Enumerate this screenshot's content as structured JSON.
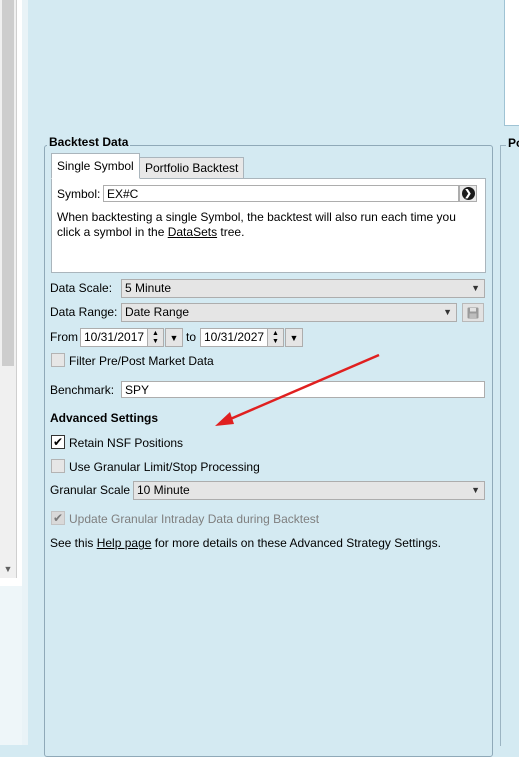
{
  "group_title": "Backtest Data",
  "right_group_title_partial": "Po",
  "tabs": [
    {
      "label": "Single Symbol"
    },
    {
      "label": "Portfolio Backtest"
    }
  ],
  "symbol": {
    "label": "Symbol:",
    "value": "EX#C",
    "go_glyph": "❯"
  },
  "single_symbol_note": {
    "part1": "When backtesting a single Symbol, the backtest will also run each time you",
    "part2": "click a symbol in the ",
    "link": "DataSets",
    "part3": " tree."
  },
  "data_scale": {
    "label": "Data Scale:",
    "value": "5 Minute"
  },
  "data_range": {
    "label": "Data Range:",
    "value": "Date Range"
  },
  "from": {
    "label": "From",
    "value": "10/31/2017"
  },
  "to": {
    "label": "to",
    "value": "10/31/2027"
  },
  "filter_prepost": {
    "label": "Filter Pre/Post Market Data",
    "checked": false
  },
  "benchmark": {
    "label": "Benchmark:",
    "value": "SPY"
  },
  "advanced": {
    "title": "Advanced Settings",
    "retain_nsf": {
      "label": "Retain NSF Positions",
      "checked": true
    },
    "granular_limit": {
      "label": "Use Granular Limit/Stop Processing",
      "checked": false
    },
    "granular_scale": {
      "label": "Granular Scale",
      "value": "10 Minute"
    },
    "update_granular": {
      "label": "Update Granular Intraday Data during Backtest",
      "checked": true,
      "disabled": true
    },
    "help": {
      "part1": "See this ",
      "link": "Help page",
      "part2": " for more details on these Advanced Strategy Settings."
    }
  },
  "icons": {
    "check": "✔",
    "dropdown": "▼",
    "spin_up": "▲",
    "spin_down": "▼",
    "scroll_down": "▼"
  },
  "colors": {
    "background": "#d4eaf2",
    "annotation_arrow": "#e02020"
  }
}
